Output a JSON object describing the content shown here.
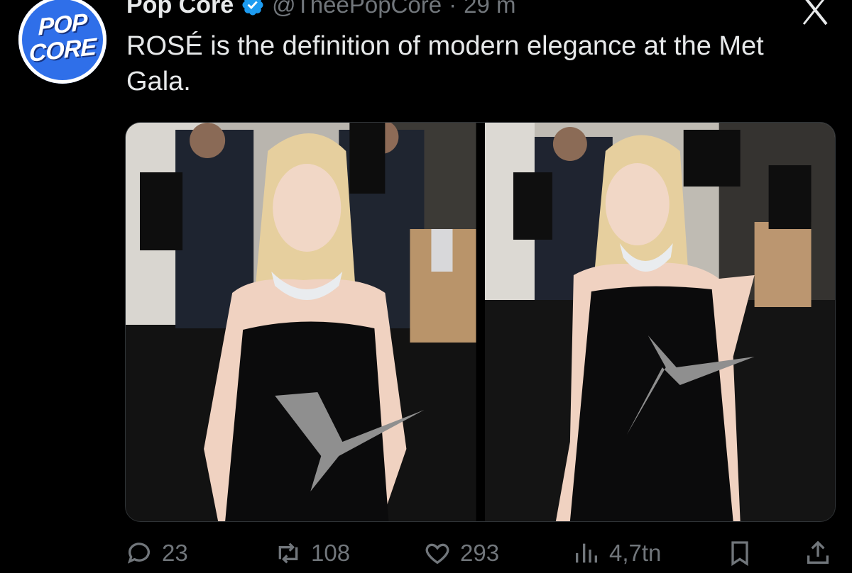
{
  "author": {
    "display_name": "Pop Core",
    "handle": "@TheePopCore",
    "separator": "·",
    "time": "29 m",
    "avatar_text": [
      "POP",
      "CORE"
    ]
  },
  "tweet": {
    "text": "ROSÉ is the definition of modern elegance at the Met Gala."
  },
  "media": {
    "images": [
      {
        "icon": "photo"
      },
      {
        "icon": "photo"
      }
    ]
  },
  "actions": {
    "replies": "23",
    "reposts": "108",
    "likes": "293",
    "views": "4,7tn"
  },
  "colors": {
    "background": "#000000",
    "text": "#e7e9ea",
    "secondary": "#71767b",
    "verified": "#1d9bf0",
    "avatar": "#2f6fe9"
  }
}
